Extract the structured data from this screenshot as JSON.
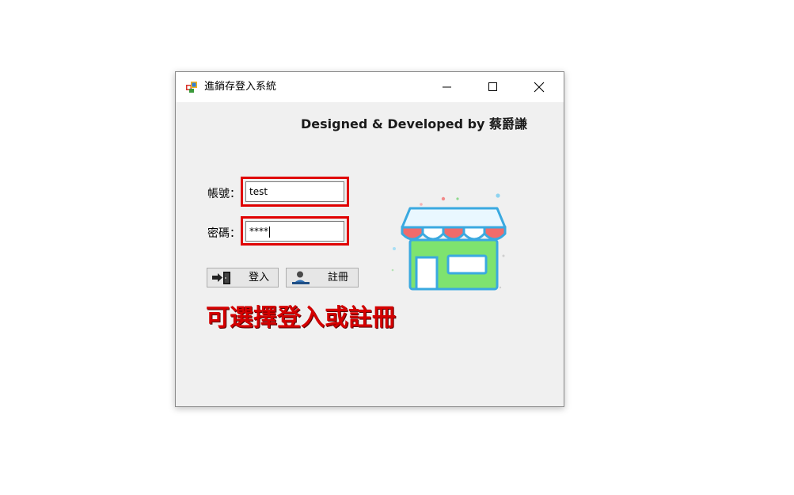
{
  "window": {
    "title": "進銷存登入系統"
  },
  "titlebar_buttons": {
    "minimize": "minimize-icon",
    "maximize": "maximize-icon",
    "close": "close-icon"
  },
  "credit": "Designed & Developed by 蔡爵謙",
  "form": {
    "account_label": "帳號：",
    "account_value": "test",
    "password_label": "密碼：",
    "password_value": "****"
  },
  "buttons": {
    "login_label": "登入",
    "register_label": "註冊"
  },
  "hint": "可選擇登入或註冊",
  "illustration": "store-icon",
  "colors": {
    "highlight": "#e00000",
    "hint_text": "#d40000"
  }
}
